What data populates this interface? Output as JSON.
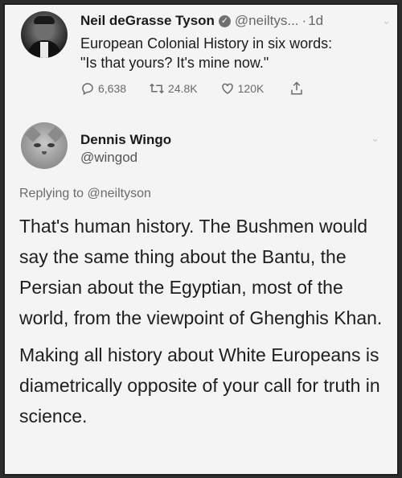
{
  "tweet1": {
    "author_name": "Neil deGrasse Tyson",
    "handle": "@neiltys...",
    "separator": "·",
    "time": "1d",
    "line1": "European Colonial History in six words:",
    "line2": "\"Is that yours? It's mine now.\"",
    "actions": {
      "replies": "6,638",
      "retweets": "24.8K",
      "likes": "120K"
    }
  },
  "tweet2": {
    "author_name": "Dennis Wingo",
    "handle": "@wingod",
    "replying_prefix": "Replying to",
    "replying_handle": "@neiltyson",
    "paragraph1": "That's human history.  The Bushmen would say the same thing about the Bantu, the Persian about the Egyptian, most of the world, from the viewpoint of Ghenghis Khan.",
    "paragraph2": "Making all history about White Europeans is diametrically opposite of your call for truth in science."
  },
  "icons": {
    "verified": "verified-badge-icon",
    "reply": "reply-icon",
    "retweet": "retweet-icon",
    "like": "heart-icon",
    "share": "share-icon",
    "more": "chevron-down-icon"
  }
}
